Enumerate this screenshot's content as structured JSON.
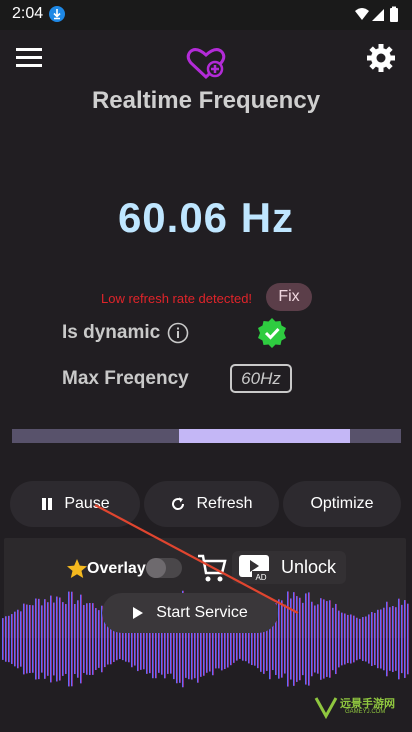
{
  "status_bar": {
    "time": "2:04",
    "download_icon": "download-icon",
    "icons": [
      "wifi-icon",
      "signal-icon",
      "battery-icon"
    ]
  },
  "header": {
    "menu_icon": "hamburger-menu-icon",
    "logo_icon": "heart-plus-icon",
    "settings_icon": "gear-icon",
    "title": "Realtime Frequency"
  },
  "frequency": {
    "value": "60.06 Hz"
  },
  "warning": {
    "text": "Low refresh rate detected!",
    "fix_label": "Fix"
  },
  "info": {
    "dynamic_label": "Is dynamic",
    "dynamic_status": "verified-check-icon",
    "max_label": "Max Freqency",
    "max_value": "60Hz"
  },
  "progress": {
    "start_fraction": 0.43,
    "end_fraction": 0.87
  },
  "controls": {
    "pause_label": "Pause",
    "refresh_label": "Refresh",
    "optimize_label": "Optimize"
  },
  "panel": {
    "overlay_label": "Overlay",
    "overlay_enabled": false,
    "unlock_label": "Unlock",
    "ad_label": "AD",
    "start_label": "Start Service"
  },
  "colors": {
    "frequency_text": "#bfe6ff",
    "warning_text": "#e0242a",
    "accent_purple": "#b32bd8",
    "check_green": "#2ecc40",
    "progress_fill": "#c4b7f6"
  },
  "watermark": {
    "text": "远景手游网",
    "sub": "GAMEYJ.COM"
  }
}
